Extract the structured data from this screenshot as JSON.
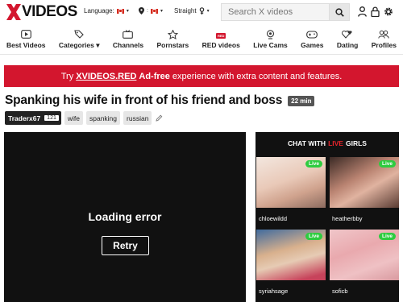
{
  "header": {
    "logo_text": "VIDEOS",
    "language_label": "Language:",
    "orientation_label": "Straight",
    "search_placeholder": "Search X videos"
  },
  "nav": [
    {
      "label": "Best Videos",
      "icon": "play-icon"
    },
    {
      "label": "Categories ▾",
      "icon": "tags-icon"
    },
    {
      "label": "Channels",
      "icon": "tv-icon"
    },
    {
      "label": "Pornstars",
      "icon": "star-icon"
    },
    {
      "label": "RED videos",
      "icon": "red-icon"
    },
    {
      "label": "Live Cams",
      "icon": "webcam-icon"
    },
    {
      "label": "Games",
      "icon": "gamepad-icon"
    },
    {
      "label": "Dating",
      "icon": "hearts-icon"
    },
    {
      "label": "Profiles",
      "icon": "profiles-icon"
    }
  ],
  "banner": {
    "prefix": "Try",
    "link": "XVIDEOS.RED",
    "bold": "Ad-free",
    "suffix": "experience with extra content and features."
  },
  "video": {
    "title": "Spanking his wife in front of his friend and boss",
    "duration": "22 min",
    "uploader": "Traderx67",
    "uploader_count": "121",
    "tags": [
      "wife",
      "spanking",
      "russian"
    ]
  },
  "player": {
    "error_text": "Loading error",
    "retry_label": "Retry"
  },
  "chat": {
    "header_prefix": "CHAT WITH",
    "header_live": "LIVE",
    "header_suffix": "GIRLS",
    "live_badge": "Live",
    "cams": [
      "chloewildd",
      "heatherbby",
      "syriahsage",
      "soficb"
    ]
  },
  "colors": {
    "brand_red": "#d3162e",
    "live_green": "#2ecc40"
  }
}
